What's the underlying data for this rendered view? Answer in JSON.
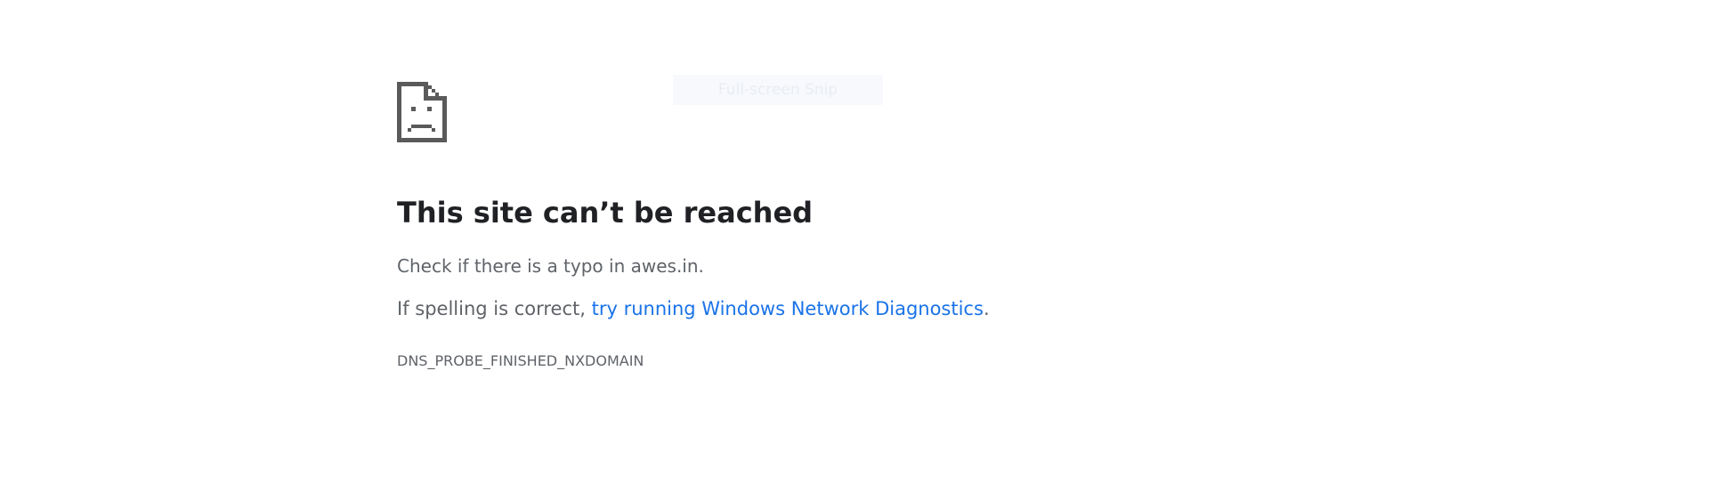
{
  "snip_overlay": {
    "label": "Full-screen Snip"
  },
  "error": {
    "icon": "sad-page-icon",
    "title": "This site can’t be reached",
    "typo_message": "Check if there is a typo in awes.in.",
    "spelling_prefix": "If spelling is correct, ",
    "diagnostics_link": "try running Windows Network Diagnostics",
    "spelling_suffix": ".",
    "code": "DNS_PROBE_FINISHED_NXDOMAIN"
  },
  "colors": {
    "title": "#202124",
    "body_text": "#5f6368",
    "link": "#1a73e8",
    "icon": "#5a5a5a"
  }
}
